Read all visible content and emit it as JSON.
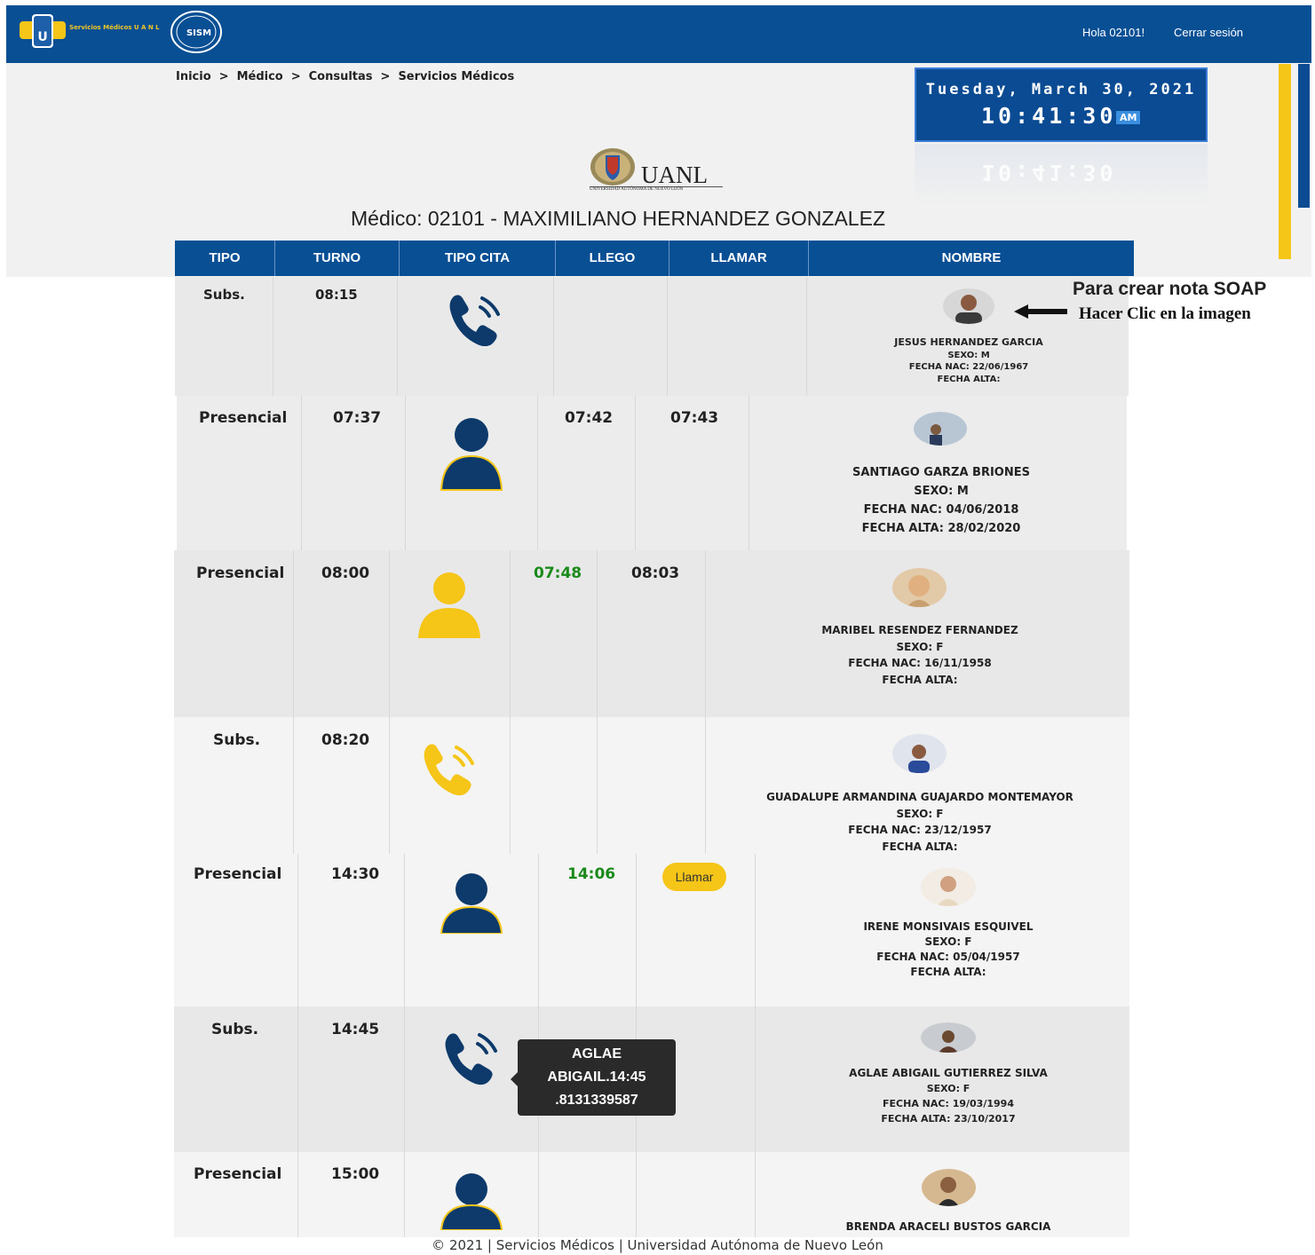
{
  "header": {
    "logo_text": "Servicios Médicos U A N L",
    "sism_label": "SISM",
    "greeting": "Hola 02101!",
    "logout": "Cerrar sesión"
  },
  "breadcrumb": [
    "Inicio",
    "Médico",
    "Consultas",
    "Servicios Médicos"
  ],
  "clock": {
    "date": "Tuesday, March 30, 2021",
    "time": "10:41:30",
    "ampm": "AM"
  },
  "uanl": {
    "name": "UANL",
    "subtitle": "UNIVERSIDAD AUTÓNOMA DE NUEVO LEÓN"
  },
  "doctor_title": "Médico: 02101 - MAXIMILIANO HERNANDEZ GONZALEZ",
  "columns": [
    "TIPO",
    "TURNO",
    "TIPO CITA",
    "LLEGO",
    "LLAMAR",
    "NOMBRE"
  ],
  "annotation": {
    "line1": "Para crear nota SOAP",
    "line2": "Hacer Clic en la imagen"
  },
  "rows": [
    {
      "tipo": "Subs.",
      "turno": "08:15",
      "cita": "phone-navy",
      "llego": "",
      "llamar": "",
      "nombre": "JESUS HERNANDEZ GARCIA",
      "sexo": "SEXO: M",
      "nac": "FECHA NAC: 22/06/1967",
      "alta": "FECHA ALTA:"
    },
    {
      "tipo": "Presencial",
      "turno": "07:37",
      "cita": "person-navy",
      "llego": "07:42",
      "llamar": "07:43",
      "nombre": "SANTIAGO GARZA BRIONES",
      "sexo": "SEXO: M",
      "nac": "FECHA NAC: 04/06/2018",
      "alta": "FECHA ALTA: 28/02/2020"
    },
    {
      "tipo": "Presencial",
      "turno": "08:00",
      "cita": "person-yellow",
      "llego": "07:48",
      "llamar": "08:03",
      "nombre": "MARIBEL RESENDEZ FERNANDEZ",
      "sexo": "SEXO: F",
      "nac": "FECHA NAC: 16/11/1958",
      "alta": "FECHA ALTA:"
    },
    {
      "tipo": "Subs.",
      "turno": "08:20",
      "cita": "phone-yellow",
      "llego": "",
      "llamar": "",
      "nombre": "GUADALUPE ARMANDINA GUAJARDO MONTEMAYOR",
      "sexo": "SEXO: F",
      "nac": "FECHA NAC: 23/12/1957",
      "alta": "FECHA ALTA:"
    },
    {
      "tipo": "Presencial",
      "turno": "14:30",
      "cita": "person-navy",
      "llego": "14:06",
      "llamar_button": "Llamar",
      "nombre": "IRENE MONSIVAIS ESQUIVEL",
      "sexo": "SEXO: F",
      "nac": "FECHA NAC: 05/04/1957",
      "alta": "FECHA ALTA:"
    },
    {
      "tipo": "Subs.",
      "turno": "14:45",
      "cita": "phone-navy",
      "llego": "",
      "llamar": "",
      "nombre": "AGLAE ABIGAIL GUTIERREZ SILVA",
      "sexo": "SEXO: F",
      "nac": "FECHA NAC: 19/03/1994",
      "alta": "FECHA ALTA: 23/10/2017"
    },
    {
      "tipo": "Presencial",
      "turno": "15:00",
      "cita": "person-navy",
      "llego": "",
      "llamar": "",
      "nombre": "BRENDA ARACELI BUSTOS GARCIA"
    }
  ],
  "tooltip": [
    "AGLAE",
    "ABIGAIL.14:45",
    ".8131339587"
  ],
  "colors": {
    "navy": "#0d3a6b",
    "yellow": "#f5c518",
    "header_blue": "#084f94",
    "green": "#1a8a1a"
  },
  "footer": "© 2021 | Servicios Médicos | Universidad Autónoma de Nuevo León"
}
